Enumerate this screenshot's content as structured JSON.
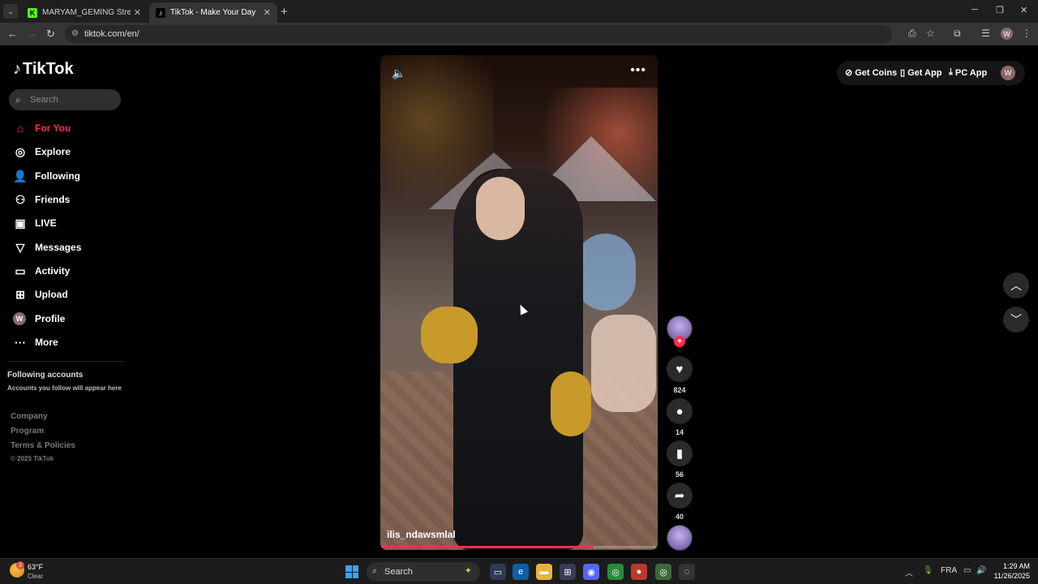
{
  "browser": {
    "tabs": [
      {
        "title": "MARYAM_GEMING Stream - Kic",
        "favicon": "kick-icon",
        "close": "✕"
      },
      {
        "title": "TikTok - Make Your Day",
        "favicon": "tiktok-icon",
        "close": "✕"
      }
    ],
    "new_tab": "+",
    "url": "tiktok.com/en/",
    "profile_initial": "W"
  },
  "sidebar": {
    "logo_text": "TikTok",
    "search_placeholder": "Search",
    "nav": [
      {
        "label": "For You",
        "icon": "home-icon",
        "active": true
      },
      {
        "label": "Explore",
        "icon": "compass-icon"
      },
      {
        "label": "Following",
        "icon": "user-following-icon"
      },
      {
        "label": "Friends",
        "icon": "friends-icon"
      },
      {
        "label": "LIVE",
        "icon": "live-icon"
      },
      {
        "label": "Messages",
        "icon": "send-icon"
      },
      {
        "label": "Activity",
        "icon": "activity-icon"
      },
      {
        "label": "Upload",
        "icon": "upload-icon"
      },
      {
        "label": "Profile",
        "icon": "profile-avatar",
        "initial": "W"
      },
      {
        "label": "More",
        "icon": "more-icon"
      }
    ],
    "following_accounts_title": "Following accounts",
    "following_accounts_sub": "Accounts you follow will appear here",
    "footer": [
      "Company",
      "Program",
      "Terms & Policies"
    ],
    "copyright": "© 2025 TikTok"
  },
  "video": {
    "username": "ilis_ndawsmlal",
    "progress": 0.77
  },
  "actions": {
    "likes": "824",
    "comments": "14",
    "saves": "56",
    "shares": "40"
  },
  "header": {
    "get_coins": "Get Coins",
    "get_app": "Get App",
    "pc_app": "PC App",
    "avatar_initial": "W"
  },
  "taskbar": {
    "temp": "63°F",
    "condition": "Clear",
    "weather_badge": "3",
    "search": "Search",
    "lang": "FRA",
    "time": "1:29 AM",
    "date": "11/26/2025"
  },
  "colors": {
    "accent": "#fe2c55",
    "background": "#000000"
  }
}
